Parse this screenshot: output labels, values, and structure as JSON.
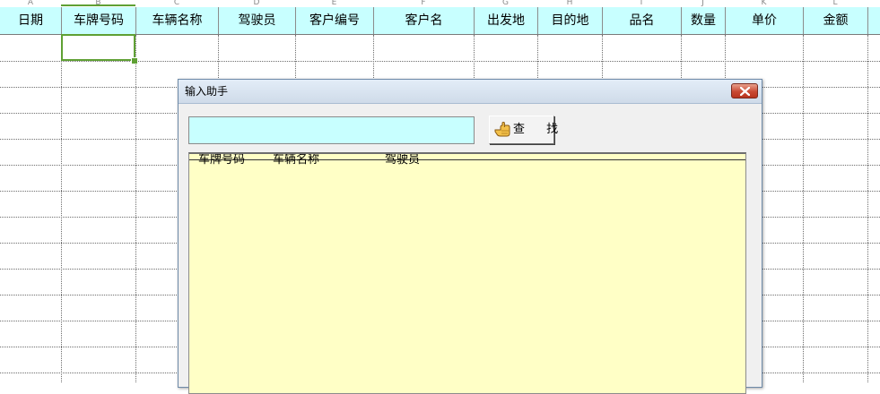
{
  "sheet": {
    "column_letters": [
      "A",
      "B",
      "C",
      "D",
      "E",
      "F",
      "G",
      "H",
      "I",
      "J",
      "K",
      "L"
    ],
    "headers": [
      "日期",
      "车牌号码",
      "车辆名称",
      "驾驶员",
      "客户编号",
      "客户名",
      "出发地",
      "目的地",
      "品名",
      "数量",
      "单价",
      "金额"
    ],
    "header_bg": "#c8ffff",
    "active_cell": "B2",
    "active_cell_color": "#5fa034"
  },
  "dialog": {
    "title": "输入助手",
    "search": {
      "value": "",
      "placeholder": ""
    },
    "find_button_label": "查 找",
    "list": {
      "columns": [
        "车牌号码",
        "车辆名称",
        "驾驶员"
      ],
      "rows": []
    },
    "list_bg": "#ffffc6",
    "search_bg": "#c8ffff"
  },
  "icons": {
    "close": "close-icon",
    "find": "pointing-hand-icon"
  }
}
